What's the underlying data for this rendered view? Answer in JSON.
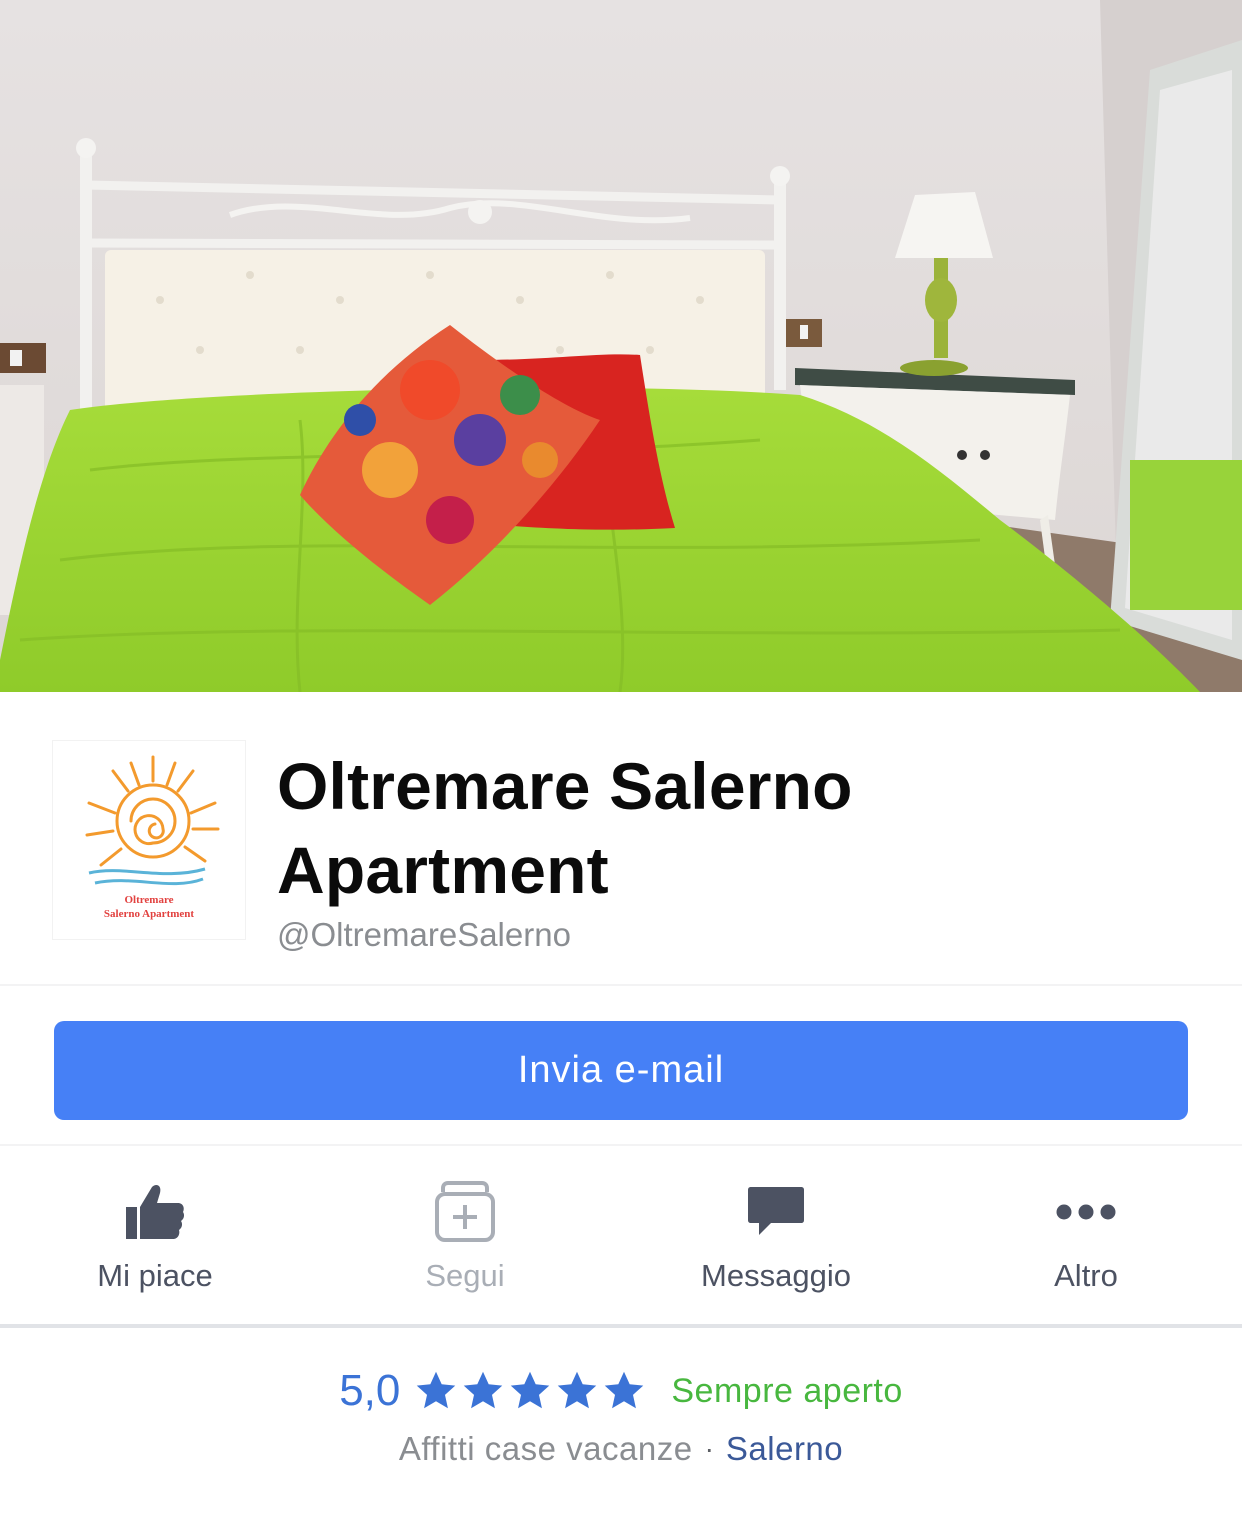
{
  "page": {
    "name": "Oltremare Salerno Apartment",
    "handle": "@OltremareSalerno",
    "logo_text_line1": "Oltremare",
    "logo_text_line2": "Salerno Apartment"
  },
  "cta": {
    "label": "Invia e-mail"
  },
  "actions": [
    {
      "label": "Mi piace",
      "icon": "thumbs-up-icon",
      "enabled": true
    },
    {
      "label": "Segui",
      "icon": "follow-add-icon",
      "enabled": false
    },
    {
      "label": "Messaggio",
      "icon": "message-bubble-icon",
      "enabled": true
    },
    {
      "label": "Altro",
      "icon": "more-dots-icon",
      "enabled": true
    }
  ],
  "info": {
    "rating": "5,0",
    "stars": 5,
    "hours": "Sempre aperto",
    "category": "Affitti case vacanze",
    "separator": "·",
    "city": "Salerno"
  },
  "colors": {
    "accent": "#4680f6",
    "rating": "#3b73d6",
    "open": "#48b73f",
    "city_link": "#3b5998",
    "secondary_text": "#8a8d91"
  }
}
